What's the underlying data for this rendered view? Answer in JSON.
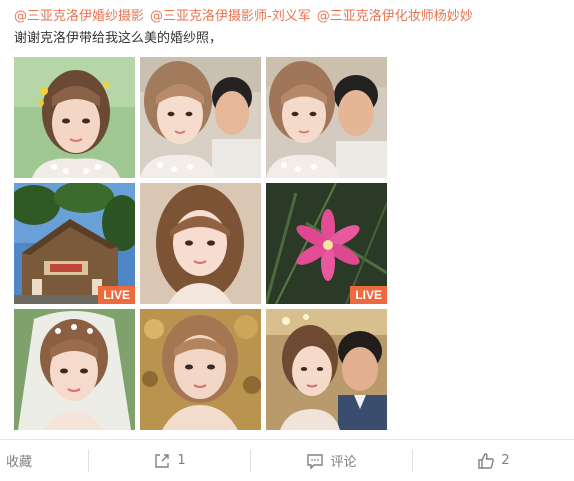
{
  "post": {
    "mentions": [
      "@三亚克洛伊婚纱摄影",
      "@三亚克洛伊摄影师-刘义军",
      "@三亚克洛伊化妆师杨妙妙"
    ],
    "text": "谢谢克洛伊带给我这么美的婚纱照，"
  },
  "photos": [
    {
      "live": null
    },
    {
      "live": null
    },
    {
      "live": null
    },
    {
      "live": "LIVE"
    },
    {
      "live": null
    },
    {
      "live": "LIVE"
    },
    {
      "live": null
    },
    {
      "live": null
    },
    {
      "live": null
    }
  ],
  "actions": {
    "favorite_label": "收藏",
    "repost_count": "1",
    "comment_label": "评论",
    "like_count": "2"
  },
  "colors": {
    "mention": "#eb7350",
    "live_badge": "#ec6a3c",
    "action_text": "#808080"
  }
}
